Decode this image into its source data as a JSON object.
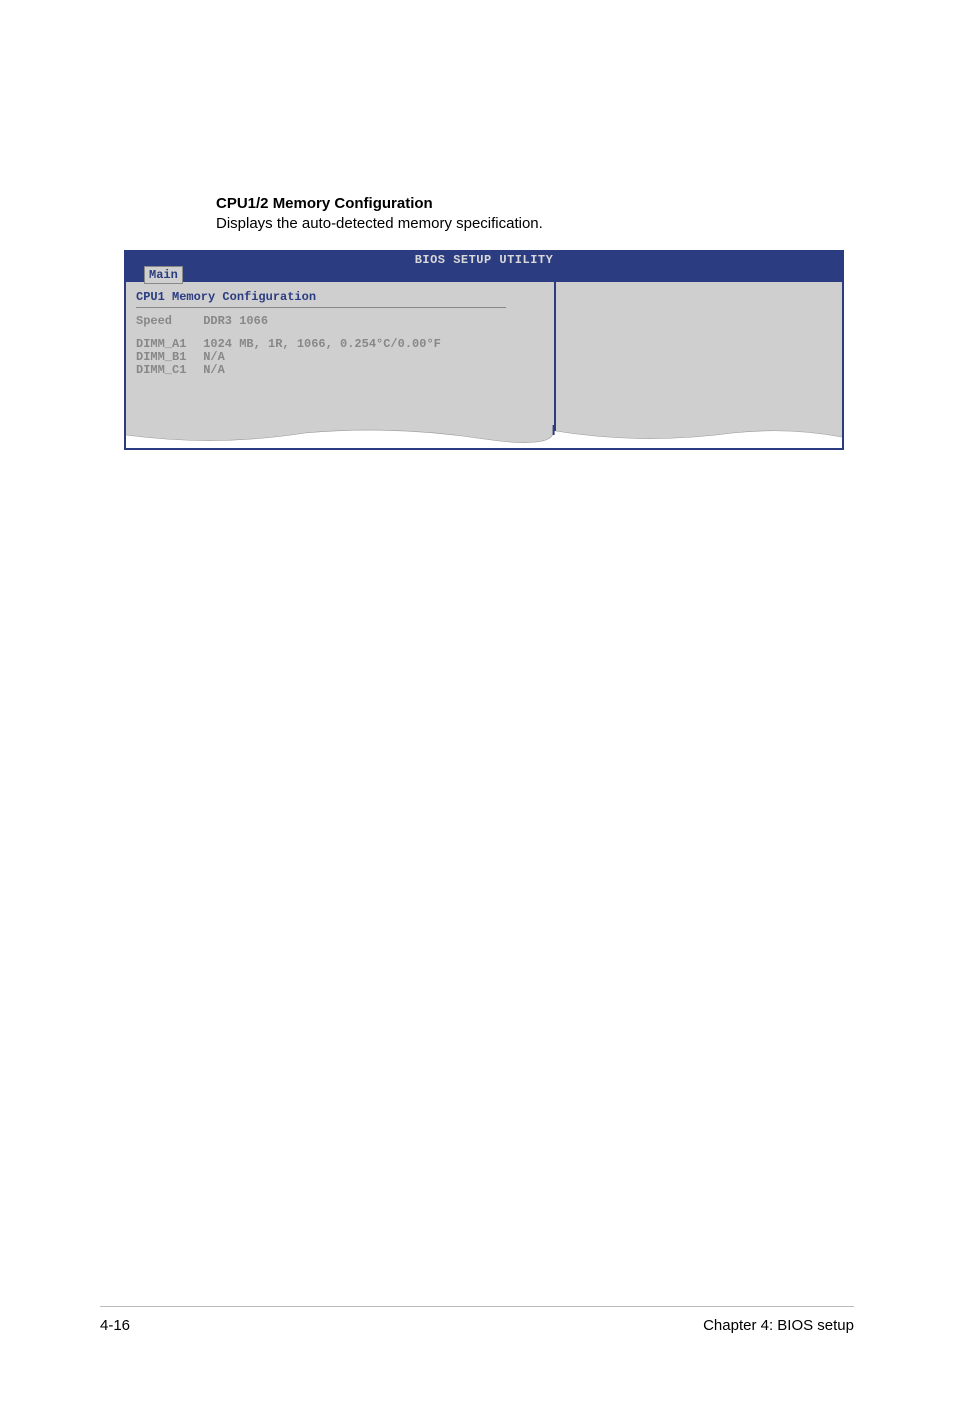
{
  "heading": {
    "title": "CPU1/2 Memory Configuration",
    "desc": "Displays the auto-detected memory specification."
  },
  "bios": {
    "title": "BIOS SETUP UTILITY",
    "tab": "Main",
    "section_title": "CPU1 Memory Configuration",
    "speed_label": "Speed",
    "speed_value": "DDR3 1066",
    "dimms": [
      {
        "label": "DIMM_A1",
        "value": "1024 MB, 1R, 1066, 0.254°C/0.00°F"
      },
      {
        "label": "DIMM_B1",
        "value": "N/A"
      },
      {
        "label": "DIMM_C1",
        "value": "N/A"
      }
    ]
  },
  "footer": {
    "page": "4-16",
    "chapter": "Chapter 4: BIOS setup"
  }
}
